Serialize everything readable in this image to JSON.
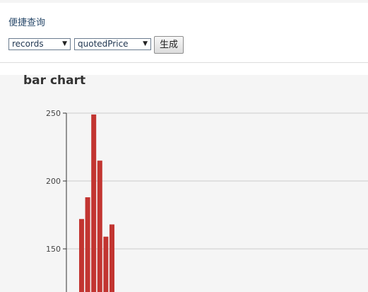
{
  "query": {
    "title": "便捷查询",
    "select_dataset": {
      "value": "records"
    },
    "select_field": {
      "value": "quotedPrice"
    },
    "generate_label": "生成"
  },
  "chart_data": {
    "type": "bar",
    "title": "bar chart",
    "xlabel": "",
    "ylabel": "",
    "y_ticks": [
      150,
      200,
      250
    ],
    "values": [
      172,
      188,
      249,
      215,
      159,
      168
    ],
    "color": "#c23531",
    "grid": true
  }
}
